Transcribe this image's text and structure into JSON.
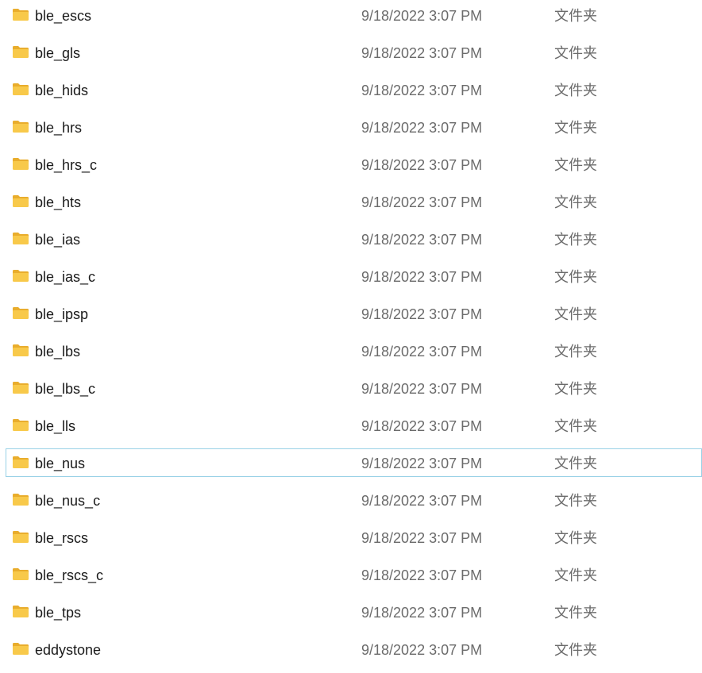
{
  "files": [
    {
      "name": "ble_escs",
      "date": "9/18/2022 3:07 PM",
      "type": "文件夹",
      "icon": "folder-icon"
    },
    {
      "name": "ble_gls",
      "date": "9/18/2022 3:07 PM",
      "type": "文件夹",
      "icon": "folder-icon"
    },
    {
      "name": "ble_hids",
      "date": "9/18/2022 3:07 PM",
      "type": "文件夹",
      "icon": "folder-icon"
    },
    {
      "name": "ble_hrs",
      "date": "9/18/2022 3:07 PM",
      "type": "文件夹",
      "icon": "folder-icon"
    },
    {
      "name": "ble_hrs_c",
      "date": "9/18/2022 3:07 PM",
      "type": "文件夹",
      "icon": "folder-icon"
    },
    {
      "name": "ble_hts",
      "date": "9/18/2022 3:07 PM",
      "type": "文件夹",
      "icon": "folder-icon"
    },
    {
      "name": "ble_ias",
      "date": "9/18/2022 3:07 PM",
      "type": "文件夹",
      "icon": "folder-icon"
    },
    {
      "name": "ble_ias_c",
      "date": "9/18/2022 3:07 PM",
      "type": "文件夹",
      "icon": "folder-icon"
    },
    {
      "name": "ble_ipsp",
      "date": "9/18/2022 3:07 PM",
      "type": "文件夹",
      "icon": "folder-icon"
    },
    {
      "name": "ble_lbs",
      "date": "9/18/2022 3:07 PM",
      "type": "文件夹",
      "icon": "folder-icon"
    },
    {
      "name": "ble_lbs_c",
      "date": "9/18/2022 3:07 PM",
      "type": "文件夹",
      "icon": "folder-icon"
    },
    {
      "name": "ble_lls",
      "date": "9/18/2022 3:07 PM",
      "type": "文件夹",
      "icon": "folder-icon"
    },
    {
      "name": "ble_nus",
      "date": "9/18/2022 3:07 PM",
      "type": "文件夹",
      "icon": "folder-icon"
    },
    {
      "name": "ble_nus_c",
      "date": "9/18/2022 3:07 PM",
      "type": "文件夹",
      "icon": "folder-icon"
    },
    {
      "name": "ble_rscs",
      "date": "9/18/2022 3:07 PM",
      "type": "文件夹",
      "icon": "folder-icon"
    },
    {
      "name": "ble_rscs_c",
      "date": "9/18/2022 3:07 PM",
      "type": "文件夹",
      "icon": "folder-icon"
    },
    {
      "name": "ble_tps",
      "date": "9/18/2022 3:07 PM",
      "type": "文件夹",
      "icon": "folder-icon"
    },
    {
      "name": "eddystone",
      "date": "9/18/2022 3:07 PM",
      "type": "文件夹",
      "icon": "folder-icon"
    }
  ],
  "hovered_index": 12,
  "colors": {
    "folder_body": "#f8c94a",
    "folder_back": "#e9ad2d",
    "hover_border": "#99d1e6",
    "name_text": "#1a1a1a",
    "meta_text": "#6b6b6b"
  }
}
